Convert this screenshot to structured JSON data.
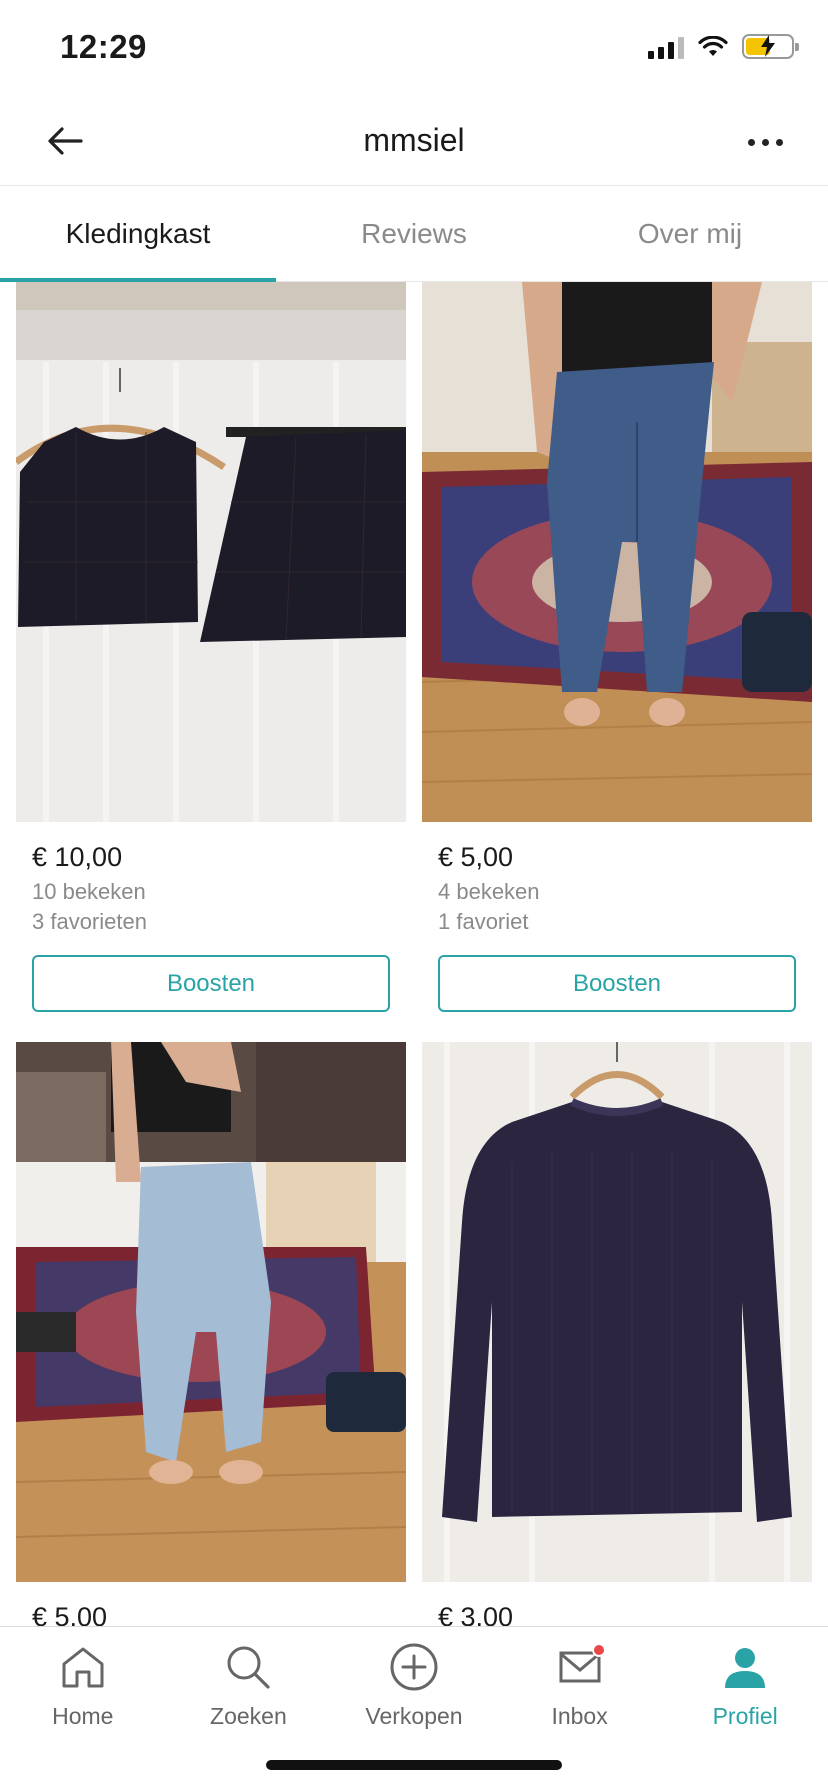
{
  "status_bar": {
    "time": "12:29"
  },
  "header": {
    "title": "mmsiel"
  },
  "tabs": [
    {
      "label": "Kledingkast",
      "active": true
    },
    {
      "label": "Reviews",
      "active": false
    },
    {
      "label": "Over mij",
      "active": false
    }
  ],
  "items": [
    {
      "price": "€ 10,00",
      "views": "10 bekeken",
      "favorites": "3 favorieten",
      "boost_label": "Boosten",
      "photo_desc": "black-crop-top-and-skirt"
    },
    {
      "price": "€ 5,00",
      "views": "4 bekeken",
      "favorites": "1 favoriet",
      "boost_label": "Boosten",
      "photo_desc": "blue-jeans"
    },
    {
      "price": "€ 5,00",
      "photo_desc": "light-blue-mom-jeans"
    },
    {
      "price": "€ 3,00",
      "photo_desc": "navy-knit-sweater"
    }
  ],
  "bottom_nav": [
    {
      "label": "Home",
      "icon": "home-icon",
      "active": false
    },
    {
      "label": "Zoeken",
      "icon": "search-icon",
      "active": false
    },
    {
      "label": "Verkopen",
      "icon": "plus-circle-icon",
      "active": false
    },
    {
      "label": "Inbox",
      "icon": "mail-icon",
      "active": false,
      "badge": true
    },
    {
      "label": "Profiel",
      "icon": "profile-icon",
      "active": true
    }
  ],
  "colors": {
    "accent": "#2aa3a6",
    "badge": "#e84848",
    "text": "#1a1a1a",
    "muted": "#8a8a8a"
  }
}
